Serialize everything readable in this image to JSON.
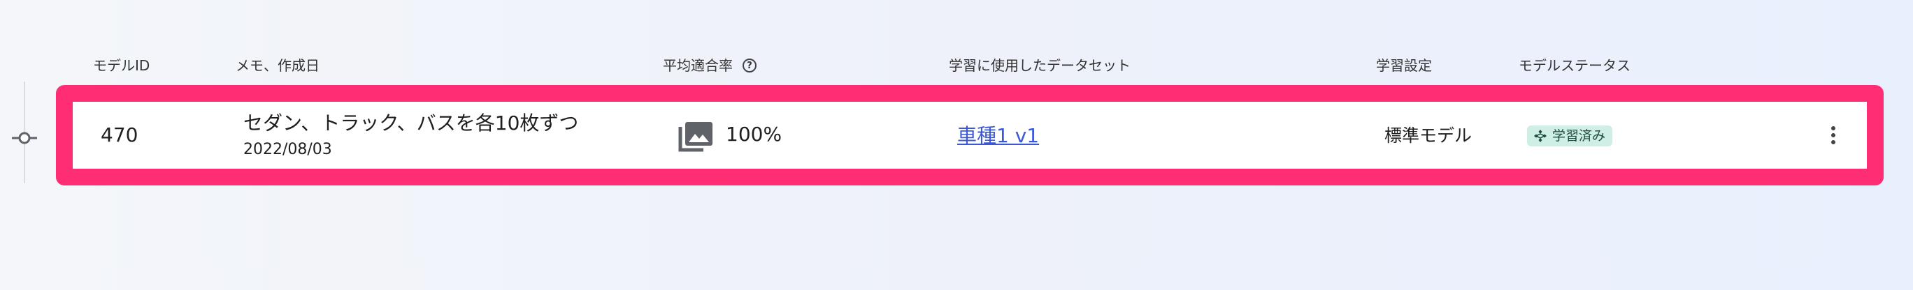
{
  "header": {
    "model_id": "モデルID",
    "memo_date": "メモ、作成日",
    "avg_rate": "平均適合率",
    "help_icon": "?",
    "dataset": "学習に使用したデータセット",
    "setting": "学習設定",
    "status": "モデルステータス"
  },
  "row": {
    "model_id": "470",
    "memo": "セダン、トラック、バスを各10枚ずつ",
    "created": "2022/08/03",
    "rate_icon": "photo-library-icon",
    "rate": "100%",
    "dataset_link": "車種1 v1",
    "setting": "標準モデル",
    "status_icon": "model-icon",
    "status": "学習済み",
    "menu_icon": "more-vert-icon"
  },
  "colors": {
    "highlight": "#ff2d73",
    "link": "#3c57d8",
    "badge_bg": "#cfeee5"
  }
}
